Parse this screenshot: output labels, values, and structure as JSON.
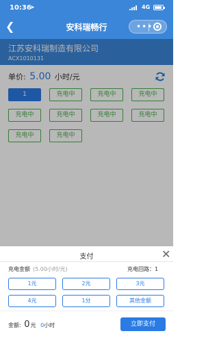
{
  "status_bar": {
    "time": "10:36",
    "network": "4G"
  },
  "nav": {
    "title": "安科瑞畅行",
    "back_icon": "chevron-left-icon"
  },
  "company": {
    "name": "江苏安科瑞制造有限公司",
    "code": "ACX1010131"
  },
  "price": {
    "label": "单价:",
    "value": "5.00",
    "unit": "小时/元"
  },
  "ports": [
    {
      "label": "1",
      "selected": true
    },
    {
      "label": "充电中"
    },
    {
      "label": "充电中"
    },
    {
      "label": "充电中"
    },
    {
      "label": "充电中"
    },
    {
      "label": "充电中"
    },
    {
      "label": "充电中"
    },
    {
      "label": "充电中"
    },
    {
      "label": "充电中"
    },
    {
      "label": "充电中"
    }
  ],
  "sheet": {
    "title": "支付",
    "amount_label": "充电金额",
    "amount_hint": "(5.00小时/元)",
    "circuit": "充电回路：1",
    "options": [
      "1元",
      "2元",
      "3元",
      "4元",
      "1分",
      "其他金额"
    ],
    "total_label": "金额:",
    "total_value": "0",
    "total_unit": "元",
    "hours_value": "0",
    "hours_unit": "小时",
    "pay_button": "立即支付"
  },
  "colors": {
    "brand": "#3b86d8",
    "accent": "#2a7be4",
    "charging": "#4cae4c"
  }
}
